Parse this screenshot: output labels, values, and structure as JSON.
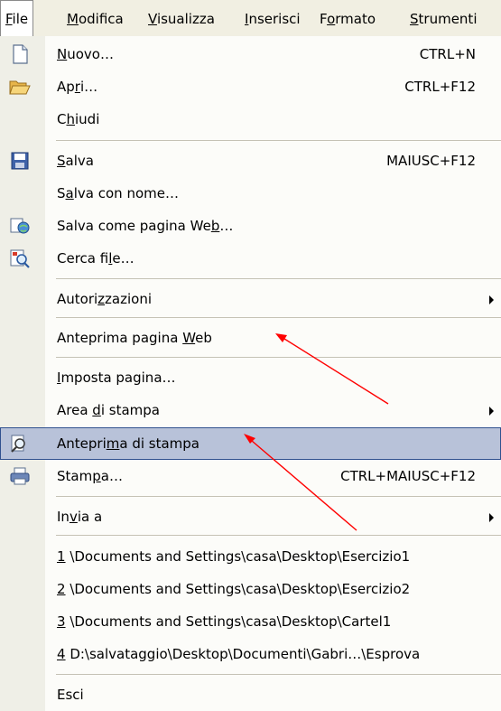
{
  "menubar": [
    {
      "pre": "",
      "u": "F",
      "post": "ile",
      "active": true
    },
    {
      "pre": "",
      "u": "M",
      "post": "odifica"
    },
    {
      "pre": "",
      "u": "V",
      "post": "isualizza"
    },
    {
      "pre": "",
      "u": "I",
      "post": "nserisci"
    },
    {
      "pre": "F",
      "u": "o",
      "post": "rmato"
    },
    {
      "pre": "",
      "u": "S",
      "post": "trumenti"
    }
  ],
  "menu": {
    "items": [
      {
        "pre": "",
        "u": "N",
        "post": "uovo…",
        "shortcut": "CTRL+N",
        "icon": "new-document-icon"
      },
      {
        "pre": "Ap",
        "u": "r",
        "post": "i…",
        "shortcut": "CTRL+F12",
        "icon": "open-folder-icon"
      },
      {
        "pre": "C",
        "u": "h",
        "post": "iudi",
        "shortcut": ""
      },
      {
        "pre": "",
        "u": "S",
        "post": "alva",
        "shortcut": "MAIUSC+F12",
        "icon": "save-disk-icon"
      },
      {
        "pre": "S",
        "u": "a",
        "post": "lva con nome…",
        "shortcut": ""
      },
      {
        "pre": "Salva come pagina We",
        "u": "b",
        "post": "…",
        "shortcut": "",
        "icon": "save-web-page-icon"
      },
      {
        "pre": "Cerca fi",
        "u": "l",
        "post": "e…",
        "shortcut": "",
        "icon": "file-search-icon"
      },
      {
        "pre": "Autori",
        "u": "z",
        "post": "zazioni",
        "shortcut": "",
        "submenu": true
      },
      {
        "pre": "Anteprima pagina ",
        "u": "W",
        "post": "eb",
        "shortcut": ""
      },
      {
        "pre": "",
        "u": "I",
        "post": "mposta pagina…",
        "shortcut": ""
      },
      {
        "pre": "Area ",
        "u": "d",
        "post": "i stampa",
        "shortcut": "",
        "submenu": true
      },
      {
        "pre": "Antepri",
        "u": "m",
        "post": "a di stampa",
        "shortcut": "",
        "icon": "print-preview-icon",
        "highlighted": true
      },
      {
        "pre": "Stam",
        "u": "p",
        "post": "a…",
        "shortcut": "CTRL+MAIUSC+F12",
        "icon": "printer-icon"
      },
      {
        "pre": "In",
        "u": "v",
        "post": "ia a",
        "shortcut": "",
        "submenu": true
      },
      {
        "pre": "",
        "u": "1",
        "post": " \\Documents and Settings\\casa\\Desktop\\Esercizio1",
        "shortcut": ""
      },
      {
        "pre": "",
        "u": "2",
        "post": " \\Documents and Settings\\casa\\Desktop\\Esercizio2",
        "shortcut": ""
      },
      {
        "pre": "",
        "u": "3",
        "post": " \\Documents and Settings\\casa\\Desktop\\Cartel1",
        "shortcut": ""
      },
      {
        "pre": "",
        "u": "4",
        "post": " D:\\salvataggio\\Desktop\\Documenti\\Gabri…\\Esprova",
        "shortcut": ""
      },
      {
        "pre": "Esci",
        "u": "",
        "post": "",
        "shortcut": ""
      }
    ]
  },
  "colors": {
    "menubar_bg": "#f1efe2",
    "menu_bg": "#fcfcf9",
    "icon_column": "#efefe7",
    "highlight_bg": "#b8c2d9",
    "highlight_border": "#30518f",
    "annotation_arrow": "#ff0000"
  }
}
